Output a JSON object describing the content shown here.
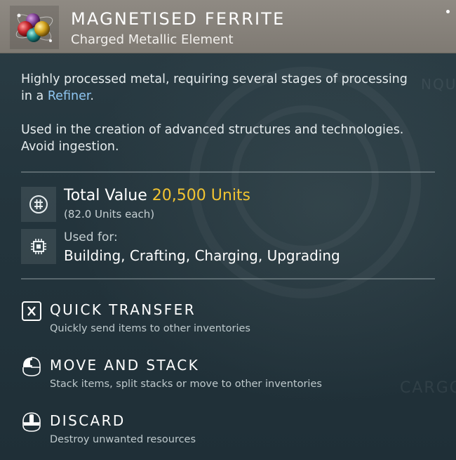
{
  "item": {
    "name": "MAGNETISED FERRITE",
    "category": "Charged Metallic Element",
    "icon": "magnetised-ferrite-orbs-icon"
  },
  "description": {
    "line1_prefix": "Highly processed metal, requiring several stages of processing",
    "line2_prefix": "in a ",
    "line2_link": "Refiner",
    "line2_suffix": ".",
    "paragraph2_line1": "Used in the creation of advanced structures and technologies.",
    "paragraph2_line2": "Avoid ingestion."
  },
  "value": {
    "label": "Total Value",
    "amount": "20,500 Units",
    "each": "(82.0 Units each)",
    "icon": "units-currency-icon"
  },
  "usage": {
    "label": "Used for:",
    "value": "Building, Crafting, Charging, Upgrading",
    "icon": "chip-icon"
  },
  "actions": [
    {
      "title": "QUICK TRANSFER",
      "description": "Quickly send items to other inventories",
      "icon": "x-key-icon"
    },
    {
      "title": "MOVE AND STACK",
      "description": "Stack items, split stacks or move to other inventories",
      "icon": "mouse-left-click-icon"
    },
    {
      "title": "DISCARD",
      "description": "Destroy unwanted resources",
      "icon": "mouse-middle-click-icon"
    }
  ],
  "colors": {
    "header": "#8a857e",
    "accent_value": "#f2c431",
    "link": "#8fc6f2",
    "panel": "#24353d"
  }
}
